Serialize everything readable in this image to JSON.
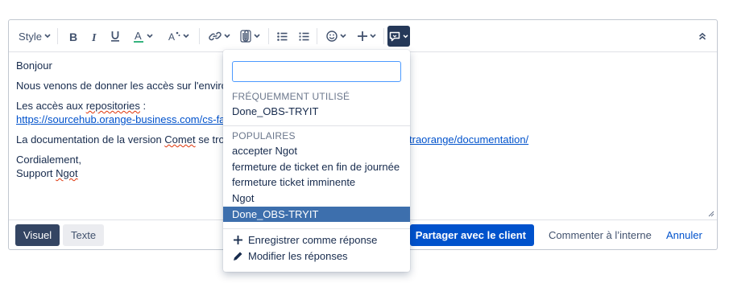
{
  "toolbar": {
    "style_label": "Style",
    "text_color_letter": "A",
    "more_formatting_letter": "A"
  },
  "content": {
    "greeting": "Bonjour",
    "line1": "Nous venons de donner les accès sur l'environ",
    "line2_prefix": "Les accès aux ",
    "line2_word": "repositories",
    "line2_suffix": " :",
    "link1": "https://sourcehub.orange-business.com/cs-fa",
    "line3_a": "La documentation de la version ",
    "line3_word": "Comet",
    "line3_b": " se trou",
    "link2_tail": "traorange/documentation/",
    "signoff": "Cordialement,",
    "signature_prefix": "Support ",
    "signature_word": "Ngot"
  },
  "footer": {
    "visual_label": "Visuel",
    "text_label": "Texte",
    "share_label": "Partager avec le client",
    "internal_label": "Commenter à l’interne",
    "cancel_label": "Annuler"
  },
  "dropdown": {
    "search_value": "",
    "frequent_header": "FRÉQUEMMENT UTILISÉ",
    "frequent_items": [
      "Done_OBS-TRYIT"
    ],
    "popular_header": "POPULAIRES",
    "popular_items": [
      "accepter Ngot",
      "fermeture de ticket en fin de journée",
      "fermeture ticket imminente",
      "Ngot",
      "Done_OBS-TRYIT"
    ],
    "selected_index": 4,
    "actions": {
      "save_label": "Enregistrer comme réponse",
      "edit_label": "Modifier les réponses"
    }
  },
  "colors": {
    "primary": "#0052cc",
    "active_dark": "#253858",
    "selected_item": "#3d6fad",
    "focus_border": "#4c9aff"
  },
  "icons": [
    "chevron-down-icon",
    "bold-icon",
    "italic-icon",
    "underline-icon",
    "text-color-icon",
    "more-formatting-icon",
    "link-icon",
    "attachment-icon",
    "bullet-list-icon",
    "numbered-list-icon",
    "emoji-icon",
    "plus-icon",
    "canned-response-icon",
    "collapse-icon",
    "pencil-icon"
  ]
}
